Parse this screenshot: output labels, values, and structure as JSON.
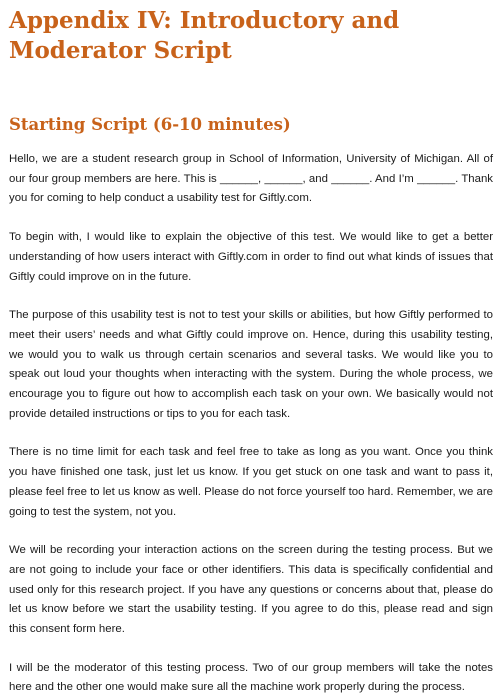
{
  "document": {
    "title": "Appendix IV: Introductory and Moderator Script",
    "section_heading": "Starting Script (6-10 minutes)",
    "paragraphs": [
      "Hello, we are a student research group in School of Information, University of Michigan. All of our four group members are here. This is ______, ______, and ______. And I’m ______. Thank you for coming to help conduct a usability test for Giftly.com.",
      "To begin with, I would like to explain the objective of this test. We would like to get a better understanding of how users interact with Giftly.com in order to find out what kinds of issues that Giftly could improve on in the future.",
      "The purpose of this usability test is not to test your skills or abilities, but how Giftly performed to meet their users’ needs and what Giftly could improve on. Hence, during this usability testing, we would you to walk us through certain scenarios and several tasks. We would like you to speak out loud your thoughts when interacting with the system. During the whole process, we encourage you to figure out how to accomplish each task on your own. We basically would not provide detailed instructions or tips to you for each task.",
      "There is no time limit for each task and feel free to take as long as you want. Once you think you have finished one task, just let us know. If you get stuck on one task and want to pass it, please feel free to let us know as well. Please do not force yourself too hard. Remember, we are going to test the system, not you.",
      "We will be recording your interaction actions on the screen during the testing process. But we are not going to include your face or other identifiers. This data is specifically confidential and used only for this research project. If you have any questions or concerns about that, please do let us know before we start the usability testing. If you agree to do this, please read and sign this consent form here.",
      "I will be the moderator of this testing process. Two of our group members will take the notes here and the other one would make sure all the machine work properly during the process."
    ]
  },
  "colors": {
    "heading": "#c8621a",
    "body_text": "#1a1a1a",
    "background": "#ffffff"
  }
}
